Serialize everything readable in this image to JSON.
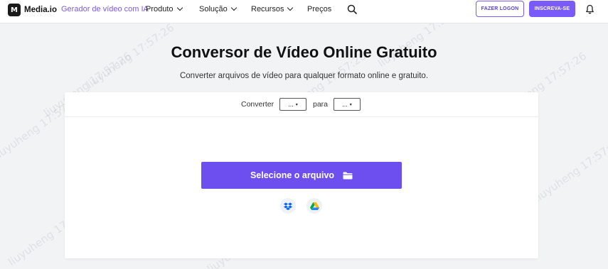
{
  "header": {
    "logo_text": "Media.io",
    "logo_mark": "M",
    "nav_ai": "Gerador de vídeo com IA",
    "nav_items": [
      {
        "label": "Produto"
      },
      {
        "label": "Solução"
      },
      {
        "label": "Recursos"
      },
      {
        "label": "Preços"
      }
    ],
    "login_label": "FAZER LOGON",
    "signup_label": "INSCREVA-SE"
  },
  "main": {
    "title": "Conversor de Vídeo Online Gratuito",
    "subtitle": "Converter arquivos de vídeo para qualquer formato online e gratuito."
  },
  "converter": {
    "convert_label": "Converter",
    "to_label": "para",
    "from_format": "...",
    "to_format": "...",
    "select_file_label": "Selecione o arquivo"
  },
  "watermark": {
    "text": "liuyuheng 17:57:26"
  },
  "colors": {
    "accent": "#7a5af8",
    "primary_button": "#6d4ff0",
    "background": "#f2f3f5"
  },
  "icons": [
    "logo-mark",
    "chevron-down-icon",
    "search-icon",
    "bell-icon",
    "dropdown-caret-icon",
    "folder-icon",
    "dropbox-icon",
    "google-drive-icon"
  ]
}
